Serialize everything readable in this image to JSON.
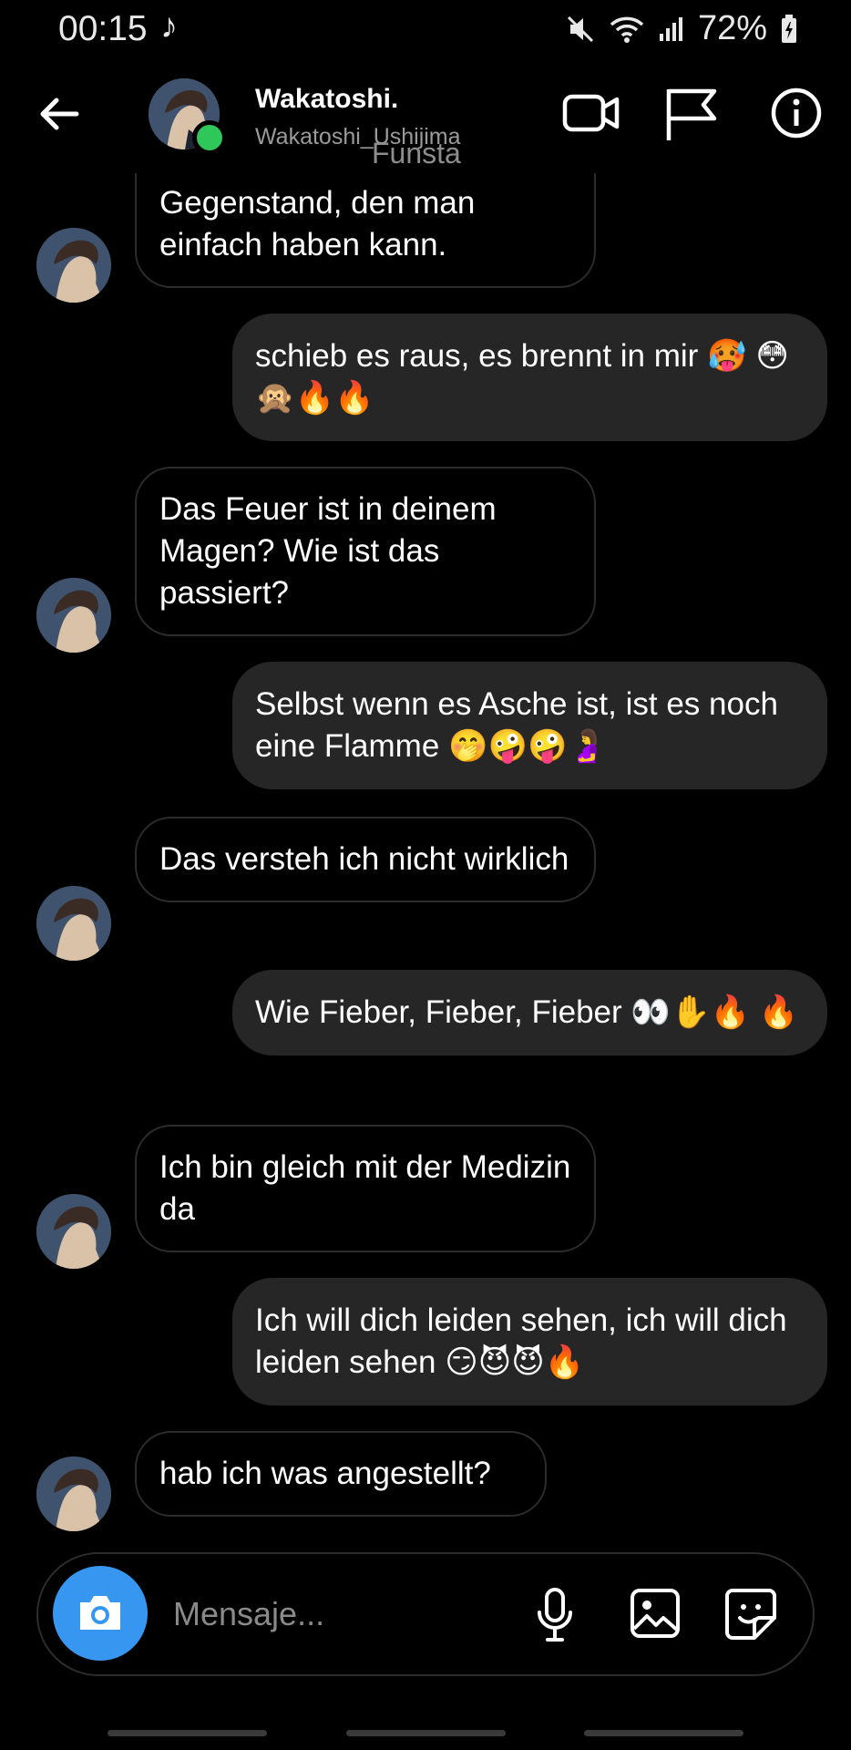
{
  "status_bar": {
    "time": "00:15",
    "music_icon": "♪",
    "battery": "72%"
  },
  "header": {
    "name": "Wakatoshi.",
    "username": "Wakatoshi_Ushijima",
    "overlay_text": "Funsta"
  },
  "messages": [
    {
      "dir": "in",
      "text": "Ich bin aber kein Gegenstand, den man einfach haben kann."
    },
    {
      "dir": "out",
      "text": "schieb es raus, es brennt in mir 🥵 😳🙊🔥🔥"
    },
    {
      "dir": "in",
      "text": "Das Feuer ist in deinem Magen? Wie ist das passiert?"
    },
    {
      "dir": "out",
      "text": "Selbst wenn es Asche ist, ist es noch eine Flamme 🤭🤪🤪🤰"
    },
    {
      "dir": "in",
      "text": "Das versteh ich nicht wirklich"
    },
    {
      "dir": "out",
      "text": "Wie Fieber, Fieber, Fieber 👀✋🔥 🔥"
    },
    {
      "dir": "in",
      "text": "Ich bin gleich mit der Medizin da"
    },
    {
      "dir": "out",
      "text": "Ich will dich leiden sehen, ich will dich leiden sehen 😏😈😈🔥"
    },
    {
      "dir": "in",
      "text": "hab ich was angestellt?"
    }
  ],
  "composer": {
    "placeholder": "Mensaje..."
  },
  "colors": {
    "background": "#000000",
    "outgoing_bubble": "#262626",
    "incoming_border": "#2c2c2c",
    "camera_button": "#3797f0",
    "online_dot": "#2fc65a"
  },
  "icons": [
    "back-arrow-icon",
    "video-call-icon",
    "flag-icon",
    "info-icon",
    "camera-icon",
    "microphone-icon",
    "gallery-icon",
    "sticker-icon"
  ]
}
